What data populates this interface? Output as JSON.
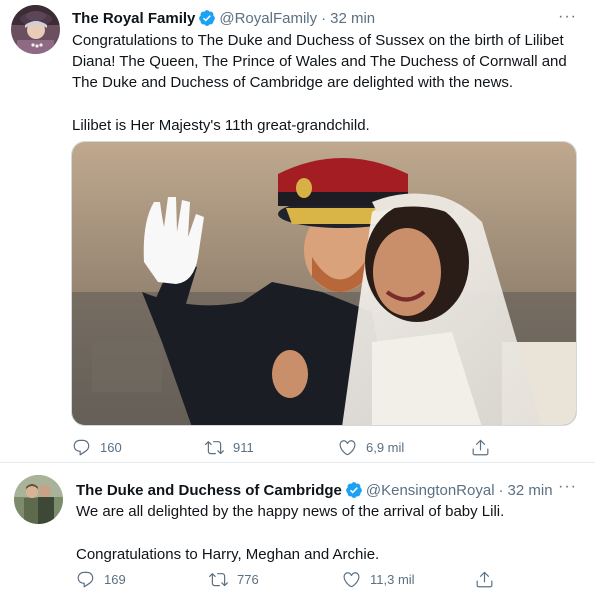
{
  "tweets": [
    {
      "author": "The Royal Family",
      "handle": "@RoyalFamily",
      "time": "32 min",
      "paragraphs": [
        "Congratulations to The Duke and Duchess of Sussex on the birth of Lilibet Diana! The Queen, The Prince of Wales and The Duchess of Cornwall and The Duke and Duchess of Cambridge are delighted with the news.",
        "Lilibet is Her Majesty's 11th great-grandchild."
      ],
      "replies": "160",
      "retweets": "911",
      "likes": "6,9 mil"
    },
    {
      "author": "The Duke and Duchess of Cambridge",
      "handle": "@KensingtonRoyal",
      "time": "32 min",
      "paragraphs": [
        "We are all delighted by the happy news of the arrival of baby Lili.",
        "Congratulations to Harry, Meghan and Archie."
      ],
      "replies": "169",
      "retweets": "776",
      "likes": "11,3 mil"
    }
  ],
  "icons": {
    "verified": "verified-badge-icon",
    "more": "more-options-icon",
    "reply": "reply-icon",
    "retweet": "retweet-icon",
    "like": "heart-icon",
    "share": "share-icon"
  },
  "colors": {
    "verified": "#1da1f2",
    "secondary_text": "#5b7083",
    "border": "#e6ecf0"
  },
  "dots": "·",
  "more_glyph": "···"
}
